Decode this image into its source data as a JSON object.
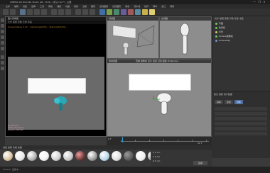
{
  "window": {
    "title": "CINEMA 4D R19.024 Studio (RC - R19) - [默认.c4d *] - 主要",
    "controls": [
      "—",
      "❐",
      "✕"
    ]
  },
  "menu": [
    "文件",
    "编辑",
    "创建",
    "选择",
    "工具",
    "网格",
    "捕捉",
    "动画",
    "模拟",
    "渲染",
    "雕刻",
    "运动跟踪",
    "运动图形",
    "角色",
    "流水线",
    "插件",
    "脚本",
    "窗口",
    "帮助"
  ],
  "render_window": {
    "title": "图片查看器",
    "menu": "文件 编辑 查看 比较 动画",
    "caption": "Using Octane 3.07... Sampling(2/20)... Standard(2/20)...",
    "stats": [
      "00:00:04 RT",
      "Status: Rendering",
      "Sample: 20/1000"
    ]
  },
  "viewports": {
    "top_left": "顶视图",
    "top_right": "右视图",
    "main": "透视视图",
    "main_menu": "查看 摄像机 显示 选项 过滤 面板 ProRender"
  },
  "object_manager": {
    "header": "文件 编辑 查看 对象 标签 书签",
    "rows": [
      {
        "name": "平面",
        "color": "#66cc66"
      },
      {
        "name": "吹风机",
        "color": "#66cc66"
      },
      {
        "name": "灯光",
        "color": "#cccc66"
      },
      {
        "name": "Octane摄像机",
        "color": "#66cc66"
      },
      {
        "name": "OctaneSky",
        "color": "#6699cc"
      }
    ]
  },
  "attributes": {
    "header": "模式 编辑 用户数据",
    "tabs": [
      "基本",
      "坐标",
      "对象"
    ],
    "active_tab": "对象"
  },
  "timeline": {
    "start": "0 F",
    "end": "90 F",
    "current": "0 F"
  },
  "materials": {
    "menu": "创建 编辑 功能 纹理",
    "swatches": [
      "#d9c2a0",
      "#e8e8e8",
      "#b0b0b0",
      "#f2f2f2",
      "#d0d0d0",
      "#c8c8c8",
      "#6b3a3a",
      "#9a9a9a",
      "#b8d8e8",
      "#e0e0e0",
      "#5a5a5a",
      "#f0f0f0",
      "#a8a8a8",
      "#dcdcdc",
      "#c0c0c0",
      "#e6e6e6"
    ]
  },
  "coordinates": {
    "rows": [
      "X 0 cm",
      "Y 0 cm",
      "Z 0 cm"
    ],
    "apply": "应用"
  },
  "status": "Octane: 渲染中..."
}
